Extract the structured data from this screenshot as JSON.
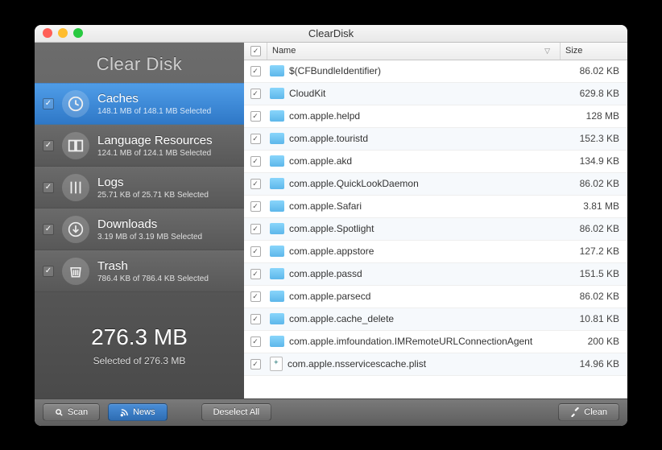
{
  "window": {
    "title": "ClearDisk"
  },
  "app_title": "Clear Disk",
  "categories": [
    {
      "id": "caches",
      "label": "Caches",
      "subtitle": "148.1 MB of 148.1 MB Selected",
      "checked": true,
      "selected": true
    },
    {
      "id": "languages",
      "label": "Language Resources",
      "subtitle": "124.1 MB of 124.1 MB Selected",
      "checked": true,
      "selected": false
    },
    {
      "id": "logs",
      "label": "Logs",
      "subtitle": "25.71 KB of 25.71 KB Selected",
      "checked": true,
      "selected": false
    },
    {
      "id": "downloads",
      "label": "Downloads",
      "subtitle": "3.19 MB of 3.19 MB Selected",
      "checked": true,
      "selected": false
    },
    {
      "id": "trash",
      "label": "Trash",
      "subtitle": "786.4 KB of 786.4 KB Selected",
      "checked": true,
      "selected": false
    }
  ],
  "totals": {
    "selected": "276.3 MB",
    "of_line": "Selected of 276.3 MB"
  },
  "columns": {
    "name": "Name",
    "size": "Size"
  },
  "items": [
    {
      "checked": true,
      "type": "folder",
      "name": "$(CFBundleIdentifier)",
      "size": "86.02 KB"
    },
    {
      "checked": true,
      "type": "folder",
      "name": "CloudKit",
      "size": "629.8 KB"
    },
    {
      "checked": true,
      "type": "folder",
      "name": "com.apple.helpd",
      "size": "128 MB"
    },
    {
      "checked": true,
      "type": "folder",
      "name": "com.apple.touristd",
      "size": "152.3 KB"
    },
    {
      "checked": true,
      "type": "folder",
      "name": "com.apple.akd",
      "size": "134.9 KB"
    },
    {
      "checked": true,
      "type": "folder",
      "name": "com.apple.QuickLookDaemon",
      "size": "86.02 KB"
    },
    {
      "checked": true,
      "type": "folder",
      "name": "com.apple.Safari",
      "size": "3.81 MB"
    },
    {
      "checked": true,
      "type": "folder",
      "name": "com.apple.Spotlight",
      "size": "86.02 KB"
    },
    {
      "checked": true,
      "type": "folder",
      "name": "com.apple.appstore",
      "size": "127.2 KB"
    },
    {
      "checked": true,
      "type": "folder",
      "name": "com.apple.passd",
      "size": "151.5 KB"
    },
    {
      "checked": true,
      "type": "folder",
      "name": "com.apple.parsecd",
      "size": "86.02 KB"
    },
    {
      "checked": true,
      "type": "folder",
      "name": "com.apple.cache_delete",
      "size": "10.81 KB"
    },
    {
      "checked": true,
      "type": "folder",
      "name": "com.apple.imfoundation.IMRemoteURLConnectionAgent",
      "size": "200 KB"
    },
    {
      "checked": true,
      "type": "file",
      "name": "com.apple.nsservicescache.plist",
      "size": "14.96 KB"
    }
  ],
  "toolbar": {
    "scan": "Scan",
    "news": "News",
    "deselect": "Deselect All",
    "clean": "Clean"
  }
}
